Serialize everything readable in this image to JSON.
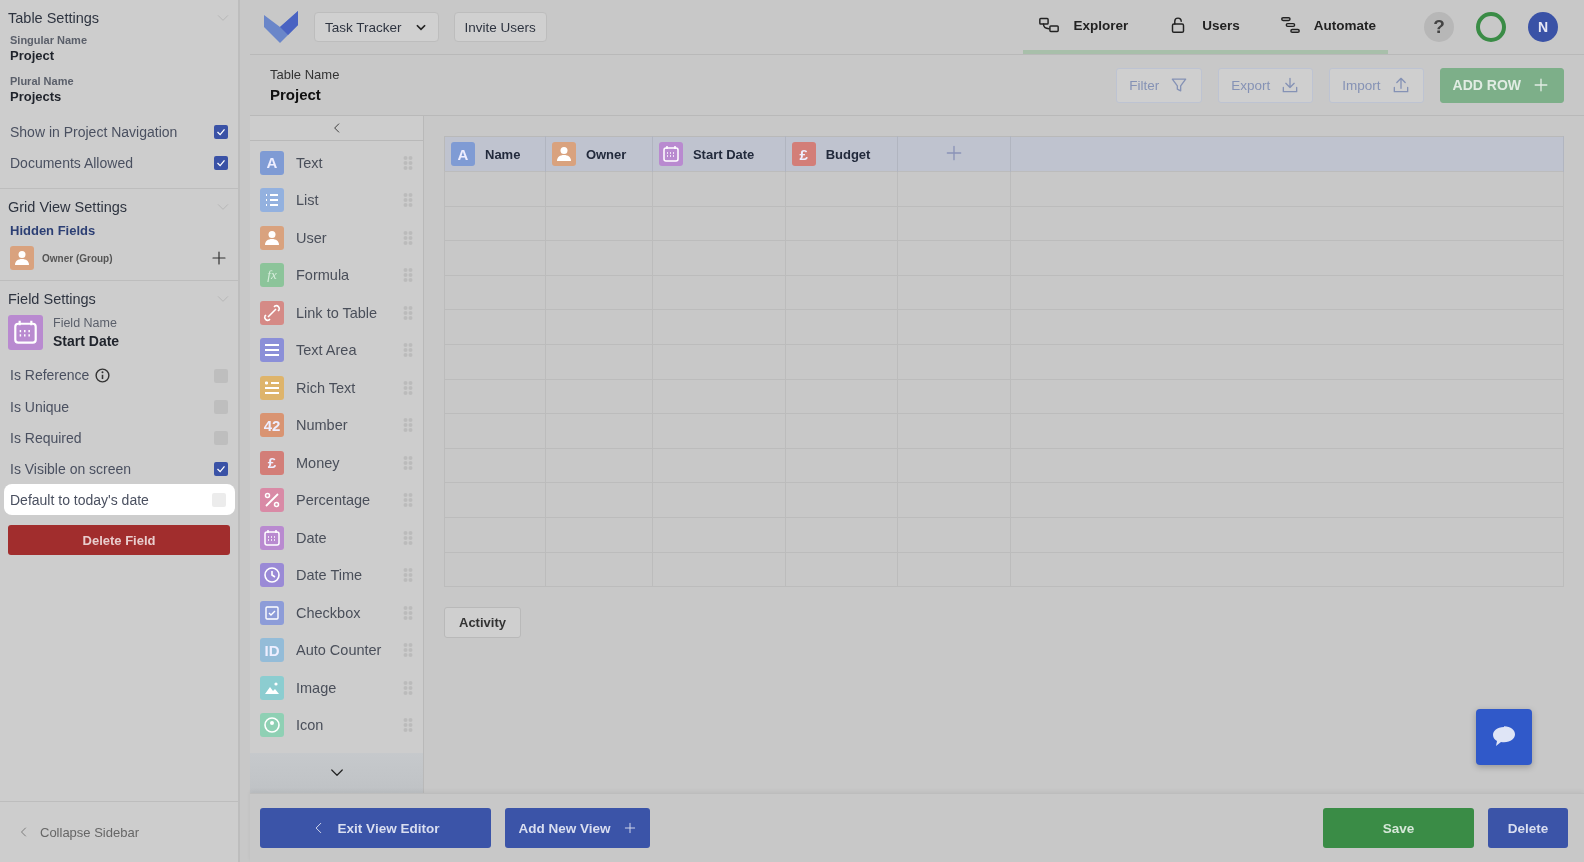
{
  "sidebar": {
    "table_settings": {
      "title": "Table Settings",
      "singular_label": "Singular Name",
      "singular_value": "Project",
      "plural_label": "Plural Name",
      "plural_value": "Projects",
      "options": [
        {
          "label": "Show in Project Navigation",
          "checked": true
        },
        {
          "label": "Documents Allowed",
          "checked": true
        }
      ]
    },
    "grid_view_settings": {
      "title": "Grid View Settings",
      "hidden_fields_label": "Hidden Fields",
      "hidden_fields": [
        {
          "label": "Owner (Group)",
          "kind": "user",
          "color": "#d9a27e"
        }
      ]
    },
    "field_settings": {
      "title": "Field Settings",
      "field_name_label": "Field Name",
      "field_name": "Start Date",
      "field": {
        "kind": "date",
        "color": "#b98ad0"
      },
      "options": [
        {
          "label": "Is Reference",
          "info": true,
          "checked": false,
          "highlighted": false
        },
        {
          "label": "Is Unique",
          "info": false,
          "checked": false,
          "highlighted": false
        },
        {
          "label": "Is Required",
          "info": false,
          "checked": false,
          "highlighted": false
        },
        {
          "label": "Is Visible on screen",
          "info": false,
          "checked": true,
          "highlighted": false
        },
        {
          "label": "Default to today's date",
          "info": false,
          "checked": false,
          "highlighted": true
        }
      ],
      "delete_button": "Delete Field"
    },
    "collapse": "Collapse Sidebar"
  },
  "header": {
    "project_menu": "Task Tracker",
    "invite_button": "Invite Users",
    "nav": [
      {
        "label": "Explorer",
        "kind": "explorer"
      },
      {
        "label": "Users",
        "kind": "lock"
      },
      {
        "label": "Automate",
        "kind": "automate"
      }
    ],
    "help": "?",
    "avatar": "N"
  },
  "table_name": {
    "label": "Table Name",
    "value": "Project"
  },
  "toolbar": [
    {
      "label": "Filter",
      "kind": "filter"
    },
    {
      "label": "Export",
      "kind": "export"
    },
    {
      "label": "Import",
      "kind": "import"
    },
    {
      "label": "ADD ROW",
      "kind": "add"
    }
  ],
  "field_types": [
    {
      "label": "Text",
      "kind": "text",
      "icon_text": "A",
      "color": "#7f9bd4"
    },
    {
      "label": "List",
      "kind": "list",
      "color": "#93b1df"
    },
    {
      "label": "User",
      "kind": "user",
      "color": "#d9a27e"
    },
    {
      "label": "Formula",
      "kind": "formula",
      "icon_text": "fx",
      "color": "#8cc49a"
    },
    {
      "label": "Link to Table",
      "kind": "link",
      "color": "#d58a86"
    },
    {
      "label": "Text Area",
      "kind": "textarea",
      "color": "#8b8fd8"
    },
    {
      "label": "Rich Text",
      "kind": "richtext",
      "color": "#deb46b"
    },
    {
      "label": "Number",
      "kind": "number",
      "icon_text": "42",
      "color": "#d99472"
    },
    {
      "label": "Money",
      "kind": "money",
      "icon_text": "£",
      "color": "#d37e78"
    },
    {
      "label": "Percentage",
      "kind": "percentage",
      "color": "#d98aa6"
    },
    {
      "label": "Date",
      "kind": "date",
      "color": "#b98ad0"
    },
    {
      "label": "Date Time",
      "kind": "datetime",
      "color": "#9a8ad6"
    },
    {
      "label": "Checkbox",
      "kind": "checkbox",
      "color": "#8d9cd8"
    },
    {
      "label": "Auto Counter",
      "kind": "counter",
      "icon_text": "ID",
      "color": "#94bcd8"
    },
    {
      "label": "Image",
      "kind": "image",
      "color": "#8ccdd0"
    },
    {
      "label": "Icon",
      "kind": "icon",
      "color": "#8fd0b4"
    }
  ],
  "table": {
    "columns": [
      {
        "label": "Name",
        "kind": "text",
        "icon_text": "A",
        "color": "#7f9bd4"
      },
      {
        "label": "Owner",
        "kind": "user",
        "color": "#d9a27e"
      },
      {
        "label": "Start Date",
        "kind": "date",
        "color": "#b98ad0"
      },
      {
        "label": "Budget",
        "kind": "money",
        "icon_text": "£",
        "color": "#d37e78"
      }
    ]
  },
  "activity_button": "Activity",
  "footer": {
    "exit_button": "Exit View Editor",
    "add_view_button": "Add New View",
    "save_button": "Save",
    "delete_button": "Delete"
  }
}
